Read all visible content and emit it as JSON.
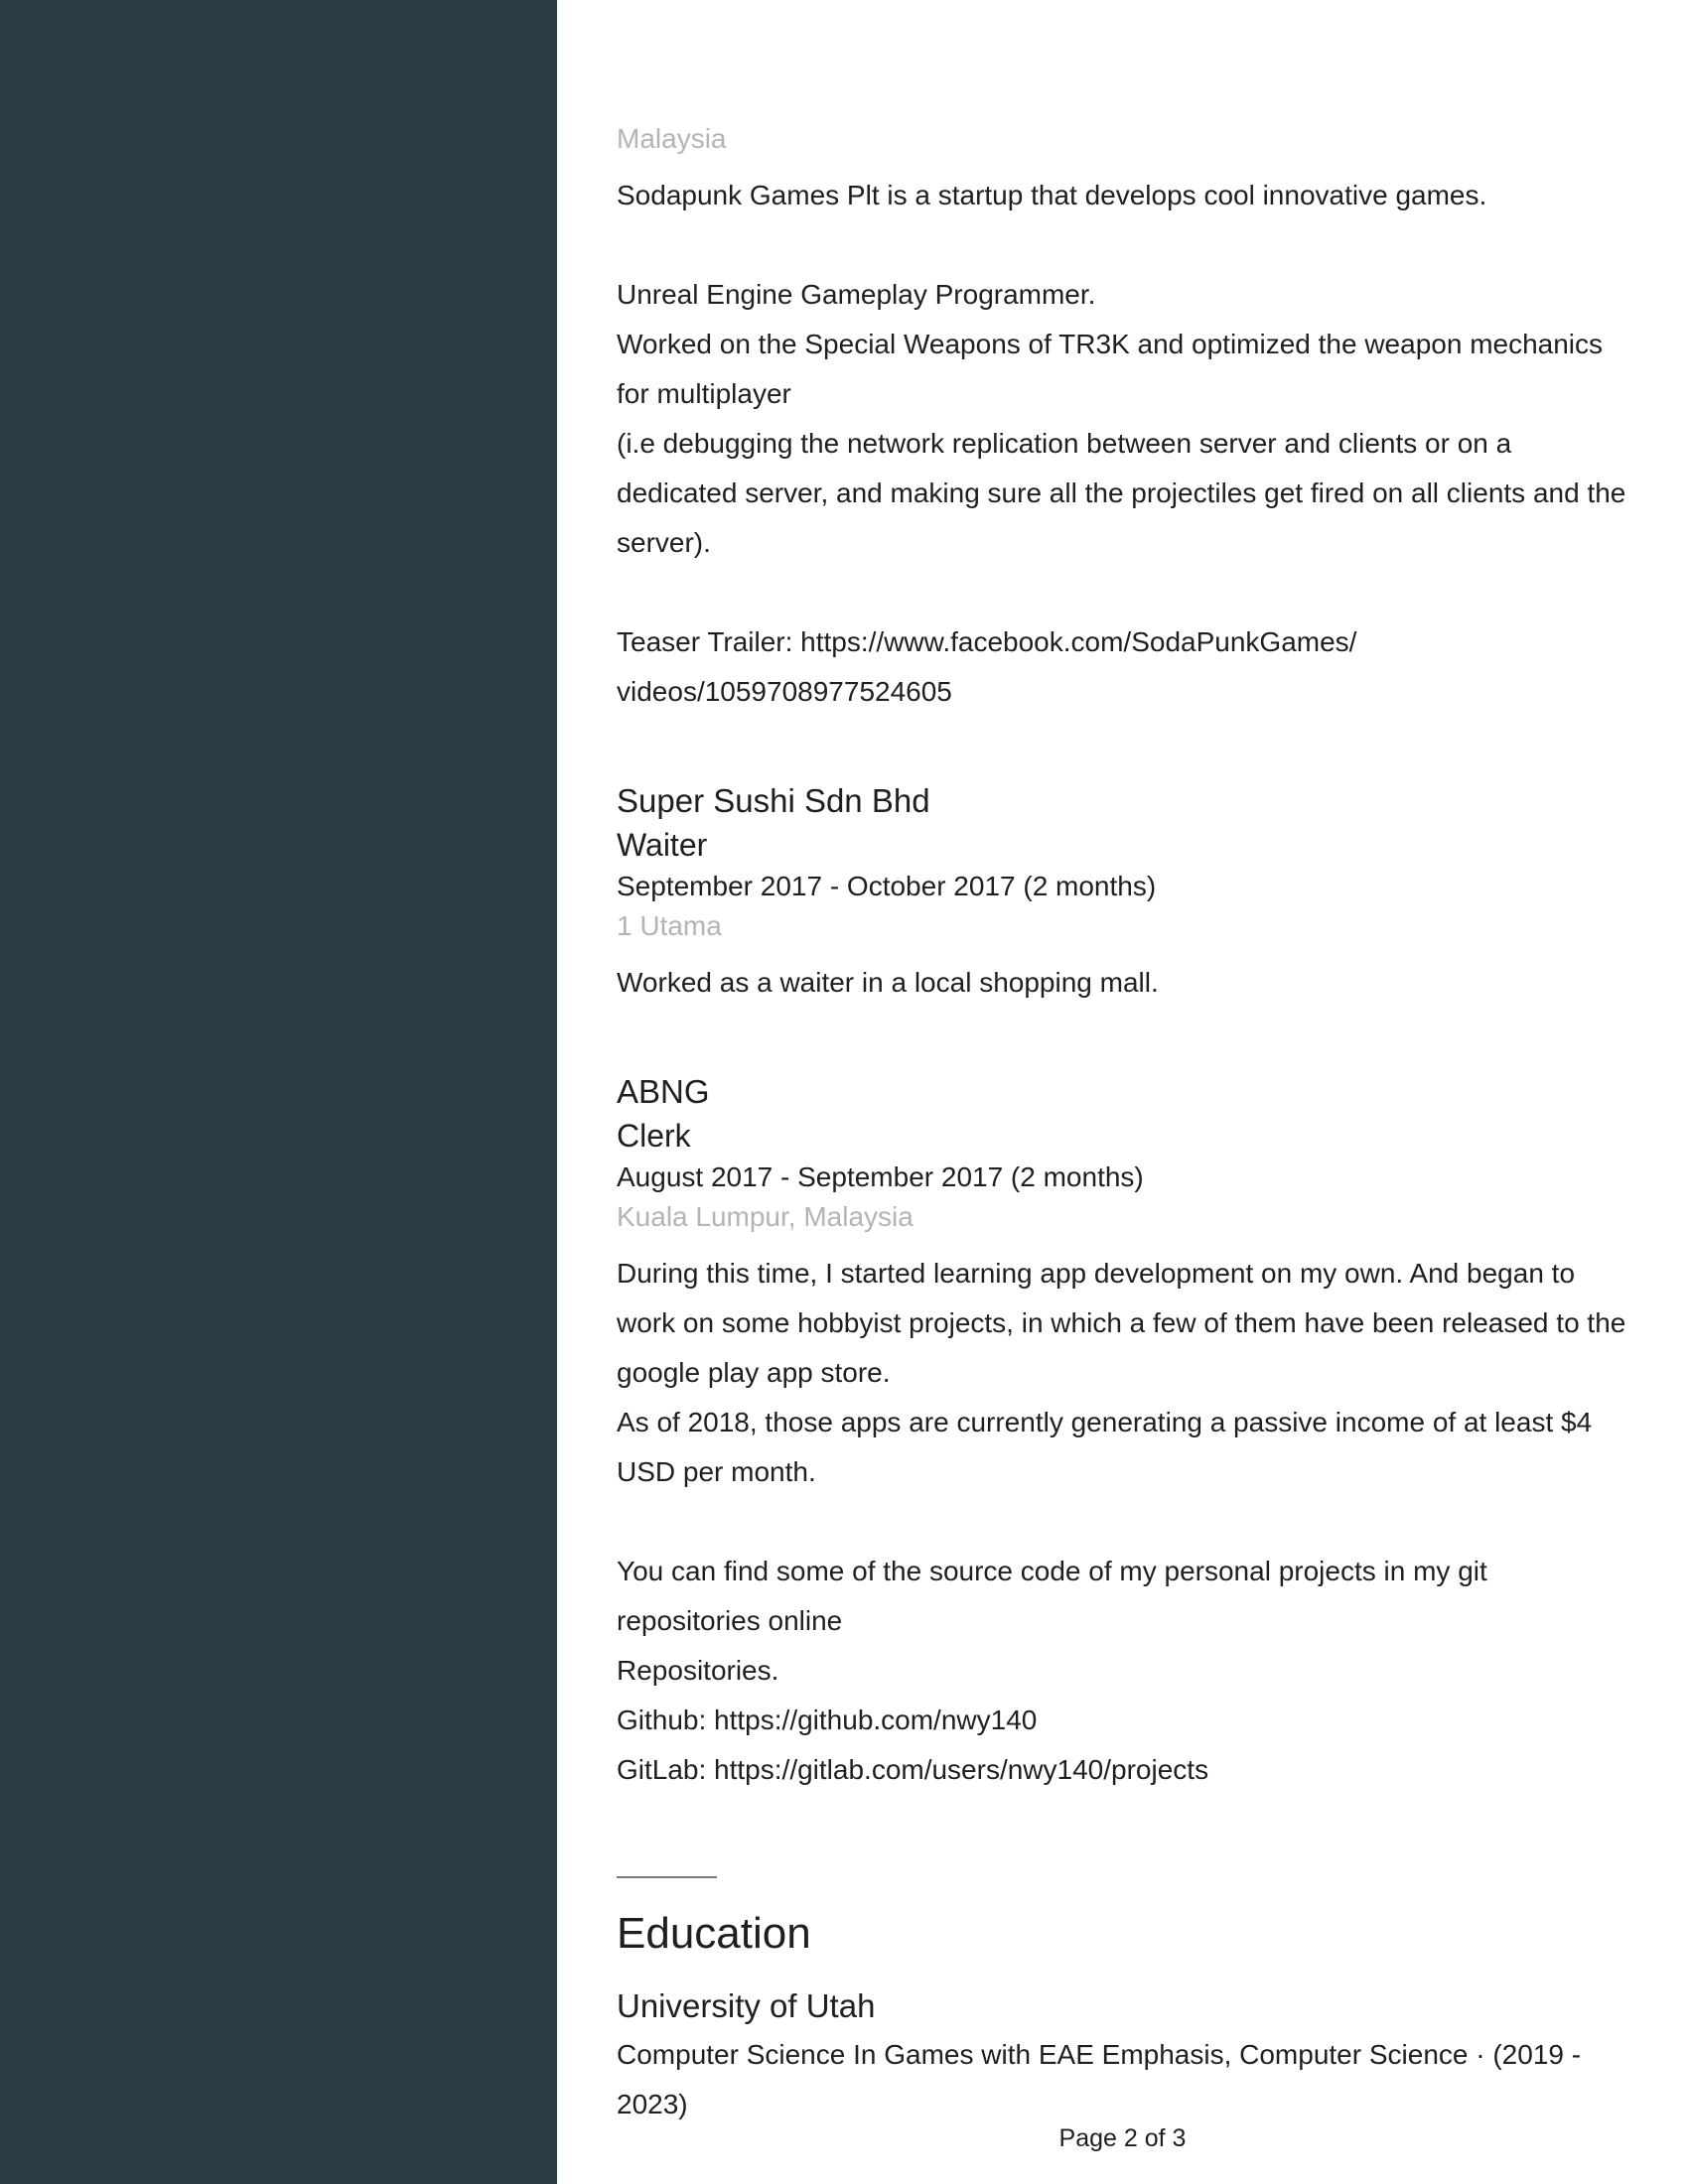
{
  "jobs": [
    {
      "location": "Malaysia",
      "description": "Sodapunk Games Plt is a startup that develops cool innovative games.\n\nUnreal Engine Gameplay Programmer.\nWorked on the Special Weapons of TR3K and optimized the weapon mechanics for multiplayer\n(i.e debugging the network replication between server and clients or on a dedicated server, and making sure all the projectiles get fired on all clients and the server).\n\nTeaser Trailer: https://www.facebook.com/SodaPunkGames/\nvideos/1059708977524605"
    },
    {
      "company": "Super Sushi Sdn Bhd",
      "title": "Waiter",
      "dates": "September 2017 - October 2017 (2 months)",
      "location": "1 Utama",
      "description": "Worked as a waiter in a local shopping mall."
    },
    {
      "company": "ABNG",
      "title": "Clerk",
      "dates": "August 2017 - September 2017 (2 months)",
      "location": "Kuala Lumpur, Malaysia",
      "description": "During this time, I started learning app development on my own. And began to work on some hobbyist projects, in which a few of them have been released to the google play app store.\nAs of 2018, those apps are currently generating a passive income of at least $4 USD per month.\n\nYou can find some of the source code of my personal projects in my git repositories online\nRepositories.\nGithub: https://github.com/nwy140\nGitLab: https://gitlab.com/users/nwy140/projects"
    }
  ],
  "education": {
    "heading": "Education",
    "school": "University of Utah",
    "degree": "Computer Science In Games with EAE Emphasis, Computer Science · (2019 - 2023)"
  },
  "footer": {
    "page": "Page 2 of 3"
  }
}
